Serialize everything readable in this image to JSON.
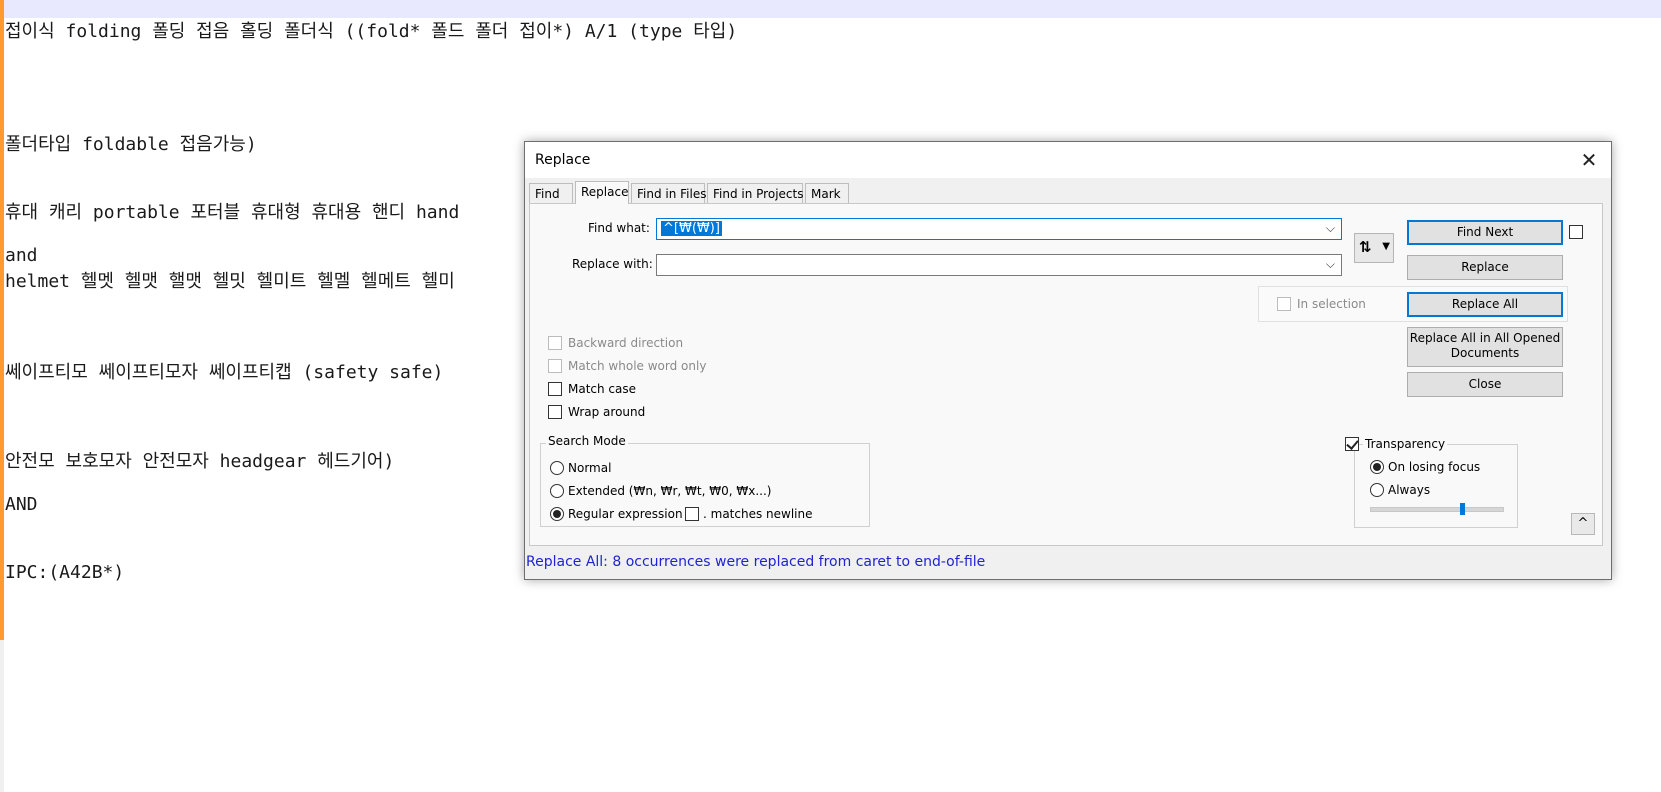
{
  "editor": {
    "lines": [
      "접이식 folding 폴딩 접음 홀딩 폴더식 ((fold* 폴드 폴더 접이*) A/1 (type 타입)",
      "폴더타입 foldable 접음가능)",
      "휴대 캐리 portable 포터블 휴대형 휴대용 핸디 hand",
      "and",
      "helmet 헬멧 헬맷 핼맷 헬밋 헬미트 헬멜 헬메트 헬미",
      "쎄이프티모 쎄이프티모자 쎄이프티캡 (safety safe)",
      "안전모 보호모자 안전모자 headgear 헤드기어)",
      "AND",
      "IPC:(A42B*)"
    ]
  },
  "dialog": {
    "title": "Replace",
    "close_icon": "close-icon",
    "tabs": [
      "Find",
      "Replace",
      "Find in Files",
      "Find in Projects",
      "Mark"
    ],
    "active_tab": "Replace",
    "find_what_label": "Find what:",
    "find_what_value": "^[₩(₩)]",
    "replace_with_label": "Replace with:",
    "replace_with_value": "",
    "swap_icon": "swap-icon",
    "buttons": {
      "find_next": "Find Next",
      "replace": "Replace",
      "replace_all": "Replace All",
      "replace_all_opened_1": "Replace All in All Opened",
      "replace_all_opened_2": "Documents",
      "close": "Close"
    },
    "in_selection": "In selection",
    "options": {
      "backward": "Backward direction",
      "whole_word": "Match whole word only",
      "match_case": "Match case",
      "wrap_around": "Wrap around"
    },
    "search_mode": {
      "title": "Search Mode",
      "normal": "Normal",
      "extended": "Extended (₩n, ₩r, ₩t, ₩0, ₩x...)",
      "regex": "Regular expression",
      "matches_newline": ". matches newline",
      "selected": "regex"
    },
    "transparency": {
      "label": "Transparency",
      "checked": true,
      "on_losing_focus": "On losing focus",
      "always": "Always",
      "selected": "on_losing_focus",
      "level": 0.7
    },
    "collapse_icon": "^",
    "status": "Replace All: 8 occurrences were replaced from caret to end-of-file",
    "colors": {
      "accent": "#0078d7",
      "status_text": "#1f24cf",
      "gutter": "#ff9a2e"
    }
  }
}
